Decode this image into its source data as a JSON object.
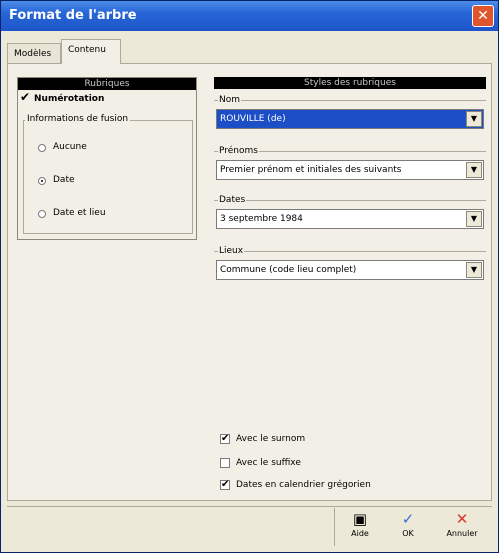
{
  "window": {
    "title": "Format de l'arbre"
  },
  "tabs": [
    {
      "label": "Modèles"
    },
    {
      "label": "Contenu"
    }
  ],
  "rubriques": {
    "header": "Rubriques",
    "numerotation": {
      "label": "Numérotation",
      "checked": true
    },
    "group_label": "Informations de fusion",
    "options": [
      {
        "label": "Aucune",
        "selected": false
      },
      {
        "label": "Date",
        "selected": true
      },
      {
        "label": "Date et lieu",
        "selected": false
      }
    ]
  },
  "styles": {
    "header": "Styles des rubriques",
    "nom": {
      "label": "Nom",
      "value": "ROUVILLE (de)"
    },
    "prenoms": {
      "label": "Prénoms",
      "value": "Premier prénom et initiales des suivants"
    },
    "dates": {
      "label": "Dates",
      "value": "3 septembre 1984"
    },
    "lieux": {
      "label": "Lieux",
      "value": "Commune (code lieu complet)"
    }
  },
  "options": [
    {
      "label": "Avec le surnom",
      "checked": true
    },
    {
      "label": "Avec le suffixe",
      "checked": false
    },
    {
      "label": "Dates en calendrier grégorien",
      "checked": true
    }
  ],
  "buttons": {
    "help": "Aide",
    "ok": "OK",
    "cancel": "Annuler"
  },
  "colors": {
    "titlebar": "#2766d6",
    "selection": "#1c4fc7",
    "ok": "#3a6fd8",
    "cancel": "#d83a2e"
  }
}
